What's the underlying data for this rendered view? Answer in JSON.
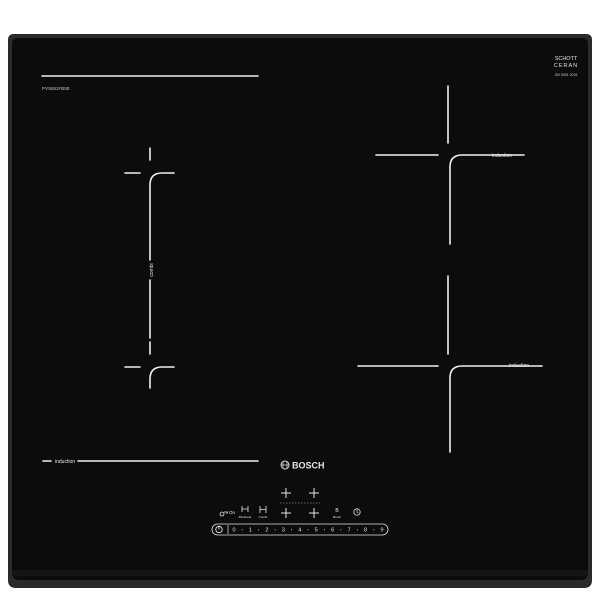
{
  "cooktop": {
    "model_number": "PVS651FB5E",
    "brand": "BOSCH",
    "certification": {
      "line1": "SCHOTT",
      "line2": "CERAN",
      "line3": "IS0 9001 2015"
    },
    "zones": {
      "combi_label": "combi",
      "front_right_label": "induction",
      "rear_right_label": "induction",
      "left_bottom_label": "induction"
    },
    "controls": {
      "main_switch": "power",
      "childlock_label": "On",
      "panboost_label": "Panboost",
      "combi_label": "Combi",
      "boost_label": "Boost",
      "timer": "timer",
      "power_levels": [
        "0",
        "1",
        "2",
        "3",
        "4",
        "5",
        "6",
        "7",
        "8",
        "9"
      ]
    },
    "colors": {
      "glass": "#0c0c0c",
      "frame": "#2a2a2a",
      "markings": "#f0f0f0"
    }
  }
}
